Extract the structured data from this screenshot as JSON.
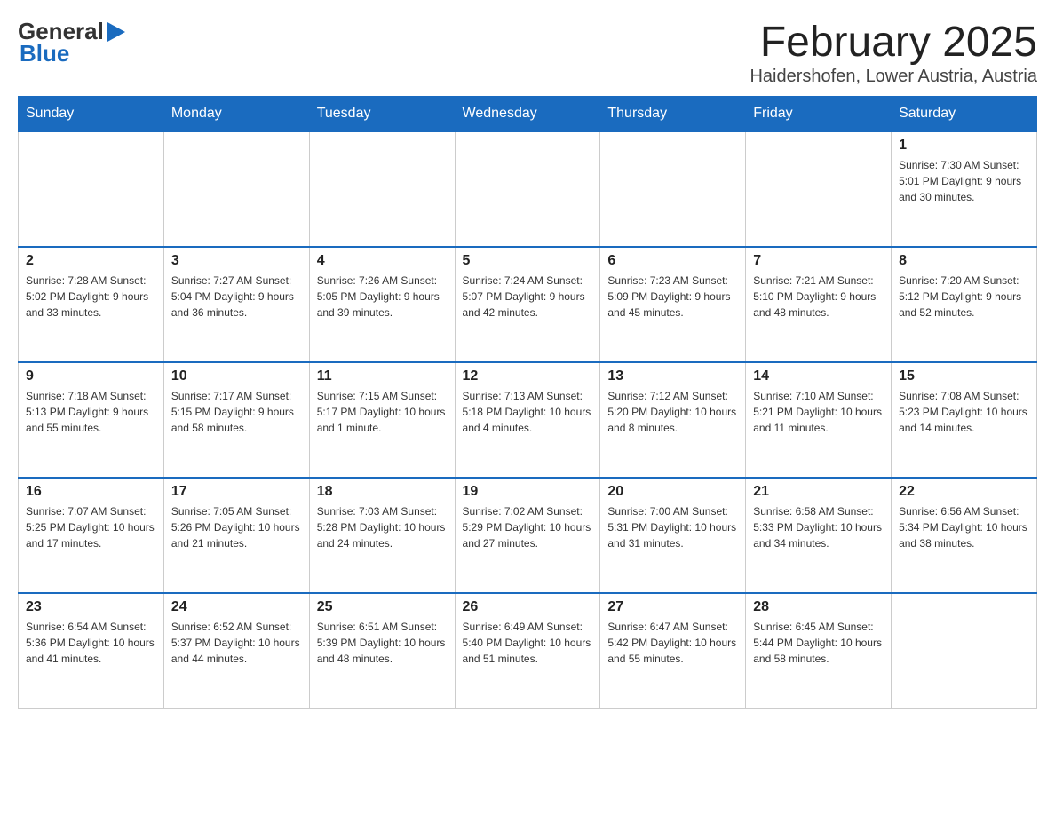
{
  "header": {
    "logo_general": "General",
    "logo_blue": "Blue",
    "title": "February 2025",
    "subtitle": "Haidershofen, Lower Austria, Austria"
  },
  "days_of_week": [
    "Sunday",
    "Monday",
    "Tuesday",
    "Wednesday",
    "Thursday",
    "Friday",
    "Saturday"
  ],
  "weeks": [
    [
      {
        "day": "",
        "info": ""
      },
      {
        "day": "",
        "info": ""
      },
      {
        "day": "",
        "info": ""
      },
      {
        "day": "",
        "info": ""
      },
      {
        "day": "",
        "info": ""
      },
      {
        "day": "",
        "info": ""
      },
      {
        "day": "1",
        "info": "Sunrise: 7:30 AM\nSunset: 5:01 PM\nDaylight: 9 hours and 30 minutes."
      }
    ],
    [
      {
        "day": "2",
        "info": "Sunrise: 7:28 AM\nSunset: 5:02 PM\nDaylight: 9 hours and 33 minutes."
      },
      {
        "day": "3",
        "info": "Sunrise: 7:27 AM\nSunset: 5:04 PM\nDaylight: 9 hours and 36 minutes."
      },
      {
        "day": "4",
        "info": "Sunrise: 7:26 AM\nSunset: 5:05 PM\nDaylight: 9 hours and 39 minutes."
      },
      {
        "day": "5",
        "info": "Sunrise: 7:24 AM\nSunset: 5:07 PM\nDaylight: 9 hours and 42 minutes."
      },
      {
        "day": "6",
        "info": "Sunrise: 7:23 AM\nSunset: 5:09 PM\nDaylight: 9 hours and 45 minutes."
      },
      {
        "day": "7",
        "info": "Sunrise: 7:21 AM\nSunset: 5:10 PM\nDaylight: 9 hours and 48 minutes."
      },
      {
        "day": "8",
        "info": "Sunrise: 7:20 AM\nSunset: 5:12 PM\nDaylight: 9 hours and 52 minutes."
      }
    ],
    [
      {
        "day": "9",
        "info": "Sunrise: 7:18 AM\nSunset: 5:13 PM\nDaylight: 9 hours and 55 minutes."
      },
      {
        "day": "10",
        "info": "Sunrise: 7:17 AM\nSunset: 5:15 PM\nDaylight: 9 hours and 58 minutes."
      },
      {
        "day": "11",
        "info": "Sunrise: 7:15 AM\nSunset: 5:17 PM\nDaylight: 10 hours and 1 minute."
      },
      {
        "day": "12",
        "info": "Sunrise: 7:13 AM\nSunset: 5:18 PM\nDaylight: 10 hours and 4 minutes."
      },
      {
        "day": "13",
        "info": "Sunrise: 7:12 AM\nSunset: 5:20 PM\nDaylight: 10 hours and 8 minutes."
      },
      {
        "day": "14",
        "info": "Sunrise: 7:10 AM\nSunset: 5:21 PM\nDaylight: 10 hours and 11 minutes."
      },
      {
        "day": "15",
        "info": "Sunrise: 7:08 AM\nSunset: 5:23 PM\nDaylight: 10 hours and 14 minutes."
      }
    ],
    [
      {
        "day": "16",
        "info": "Sunrise: 7:07 AM\nSunset: 5:25 PM\nDaylight: 10 hours and 17 minutes."
      },
      {
        "day": "17",
        "info": "Sunrise: 7:05 AM\nSunset: 5:26 PM\nDaylight: 10 hours and 21 minutes."
      },
      {
        "day": "18",
        "info": "Sunrise: 7:03 AM\nSunset: 5:28 PM\nDaylight: 10 hours and 24 minutes."
      },
      {
        "day": "19",
        "info": "Sunrise: 7:02 AM\nSunset: 5:29 PM\nDaylight: 10 hours and 27 minutes."
      },
      {
        "day": "20",
        "info": "Sunrise: 7:00 AM\nSunset: 5:31 PM\nDaylight: 10 hours and 31 minutes."
      },
      {
        "day": "21",
        "info": "Sunrise: 6:58 AM\nSunset: 5:33 PM\nDaylight: 10 hours and 34 minutes."
      },
      {
        "day": "22",
        "info": "Sunrise: 6:56 AM\nSunset: 5:34 PM\nDaylight: 10 hours and 38 minutes."
      }
    ],
    [
      {
        "day": "23",
        "info": "Sunrise: 6:54 AM\nSunset: 5:36 PM\nDaylight: 10 hours and 41 minutes."
      },
      {
        "day": "24",
        "info": "Sunrise: 6:52 AM\nSunset: 5:37 PM\nDaylight: 10 hours and 44 minutes."
      },
      {
        "day": "25",
        "info": "Sunrise: 6:51 AM\nSunset: 5:39 PM\nDaylight: 10 hours and 48 minutes."
      },
      {
        "day": "26",
        "info": "Sunrise: 6:49 AM\nSunset: 5:40 PM\nDaylight: 10 hours and 51 minutes."
      },
      {
        "day": "27",
        "info": "Sunrise: 6:47 AM\nSunset: 5:42 PM\nDaylight: 10 hours and 55 minutes."
      },
      {
        "day": "28",
        "info": "Sunrise: 6:45 AM\nSunset: 5:44 PM\nDaylight: 10 hours and 58 minutes."
      },
      {
        "day": "",
        "info": ""
      }
    ]
  ]
}
